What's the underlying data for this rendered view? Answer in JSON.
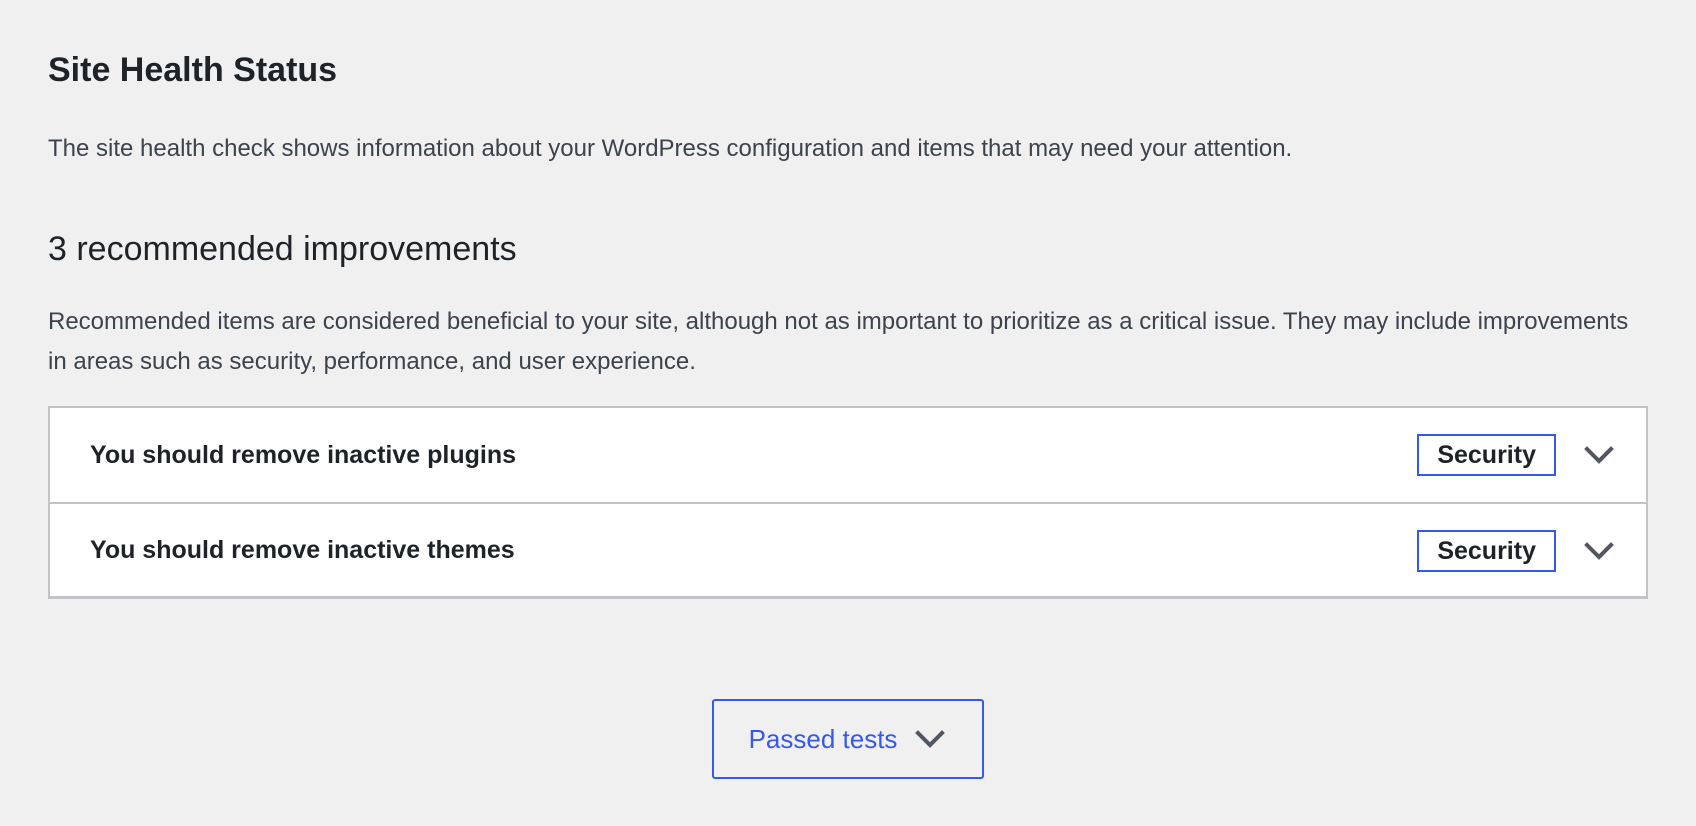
{
  "header": {
    "title": "Site Health Status",
    "description": "The site health check shows information about your WordPress configuration and items that may need your attention."
  },
  "recommended": {
    "title": "3 recommended improvements",
    "description": "Recommended items are considered beneficial to your site, although not as important to prioritize as a critical issue. They may include improvements in areas such as security, performance, and user experience.",
    "items": [
      {
        "label": "You should remove inactive plugins",
        "badge": "Security",
        "icon": "chevron-down-icon"
      },
      {
        "label": "You should remove inactive themes",
        "badge": "Security",
        "icon": "chevron-down-icon"
      }
    ]
  },
  "passed": {
    "label": "Passed tests",
    "icon": "chevron-down-icon"
  },
  "colors": {
    "accent": "#3858e9",
    "text": "#1d2327",
    "muted_text": "#3c434a",
    "border": "#c3c4c7",
    "background": "#f0f0f1",
    "panel": "#ffffff"
  }
}
